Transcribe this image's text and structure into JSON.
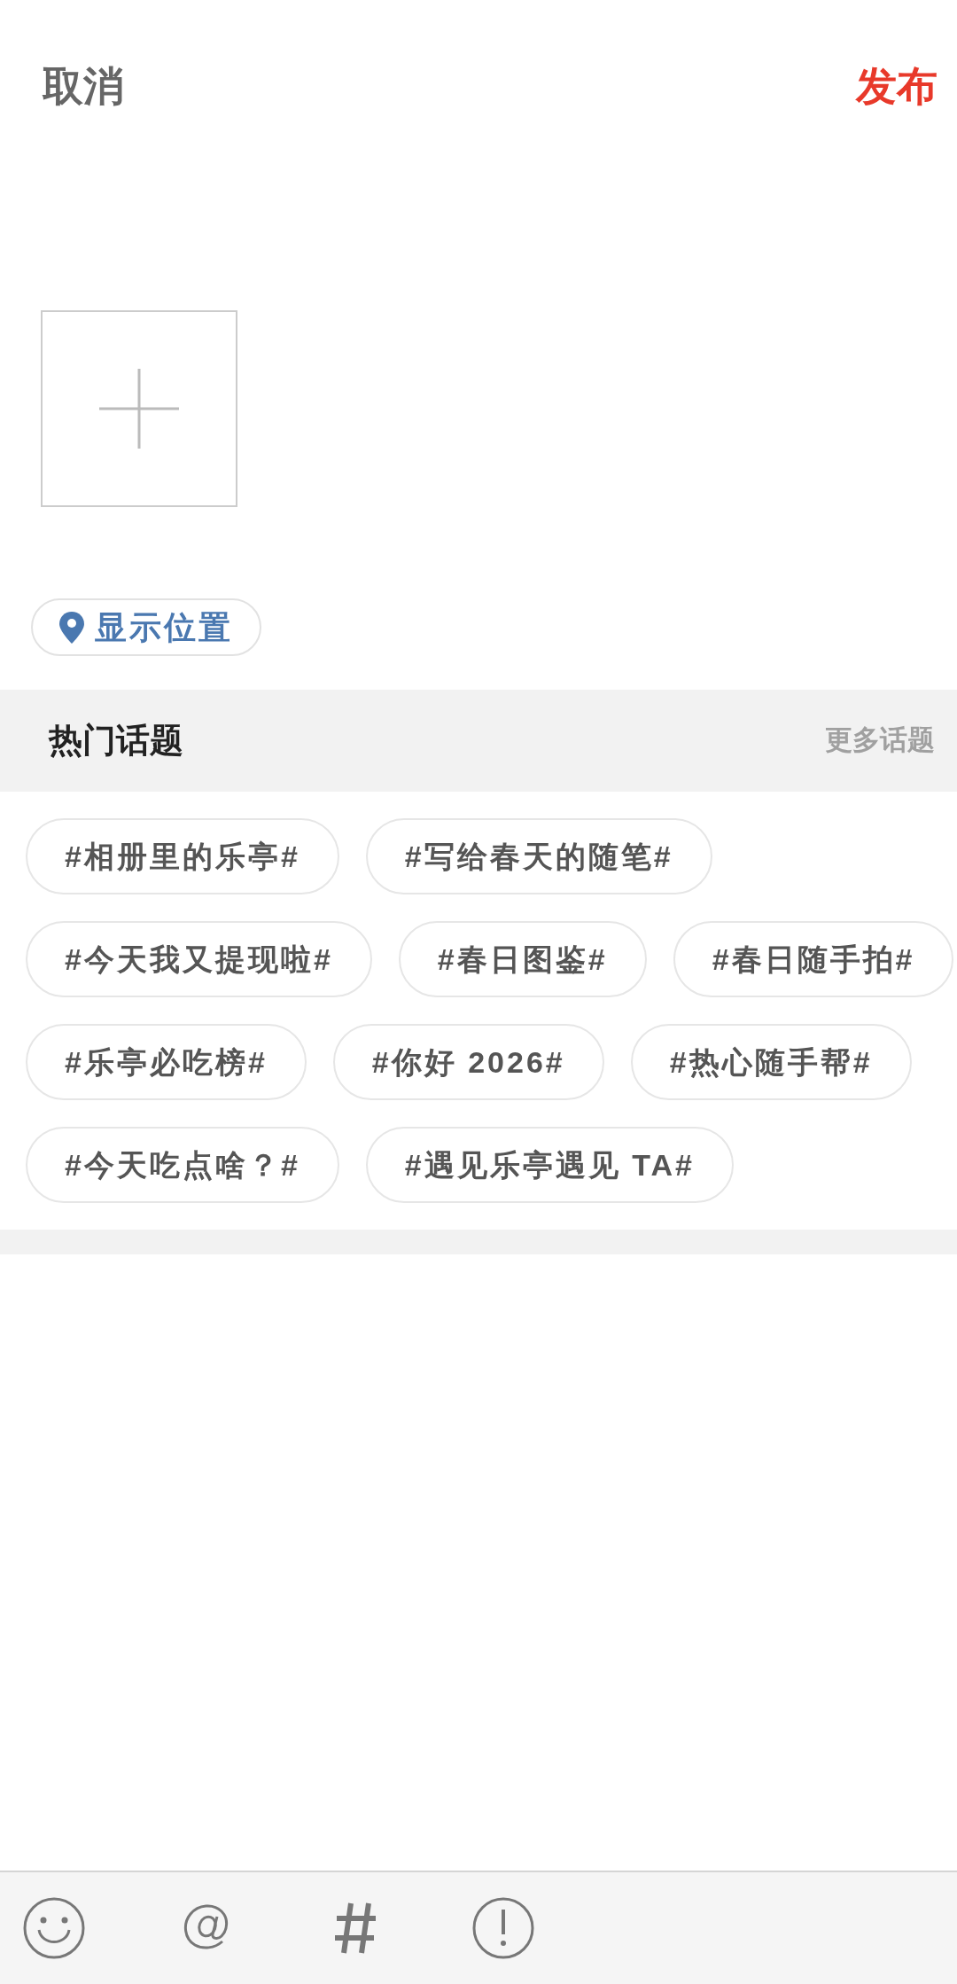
{
  "header": {
    "cancel": "取消",
    "publish": "发布"
  },
  "location": {
    "label": "显示位置"
  },
  "hot_topics": {
    "title": "热门话题",
    "more": "更多话题",
    "topics": [
      "#相册里的乐亭#",
      "#写给春天的随笔#",
      "#今天我又提现啦#",
      "#春日图鉴#",
      "#春日随手拍#",
      "#乐亭必吃榜#",
      "#你好 2026#",
      "#热心随手帮#",
      "#今天吃点啥？#",
      "#遇见乐亭遇见 TA#"
    ]
  }
}
